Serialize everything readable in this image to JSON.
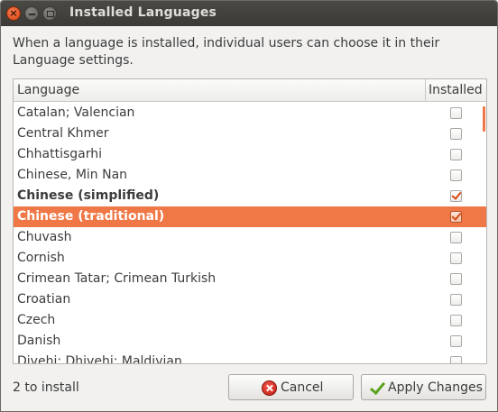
{
  "window": {
    "title": "Installed Languages"
  },
  "description": "When a language is installed, individual users can choose it in their Language settings.",
  "table": {
    "columns": [
      "Language",
      "Installed"
    ],
    "rows": [
      {
        "language": "Catalan; Valencian",
        "installed": false
      },
      {
        "language": "Central Khmer",
        "installed": false
      },
      {
        "language": "Chhattisgarhi",
        "installed": false
      },
      {
        "language": "Chinese, Min Nan",
        "installed": false
      },
      {
        "language": "Chinese (simplified)",
        "installed": true,
        "emphasis": "bold"
      },
      {
        "language": "Chinese (traditional)",
        "installed": true,
        "emphasis": "selected"
      },
      {
        "language": "Chuvash",
        "installed": false
      },
      {
        "language": "Cornish",
        "installed": false
      },
      {
        "language": "Crimean Tatar; Crimean Turkish",
        "installed": false
      },
      {
        "language": "Croatian",
        "installed": false
      },
      {
        "language": "Czech",
        "installed": false
      },
      {
        "language": "Danish",
        "installed": false
      },
      {
        "language": "Divehi; Dhivehi; Maldivian",
        "installed": false
      }
    ]
  },
  "status": "2 to install",
  "buttons": {
    "cancel": "Cancel",
    "apply": "Apply Changes"
  },
  "colors": {
    "accent": "#f07746",
    "titlebar": "#3b3a36",
    "window_bg": "#f2f1f0"
  },
  "icons": {
    "close": "close-icon",
    "minimize": "minimize-icon",
    "maximize": "maximize-icon",
    "cancel": "cancel-icon",
    "apply": "checkmark-icon"
  }
}
